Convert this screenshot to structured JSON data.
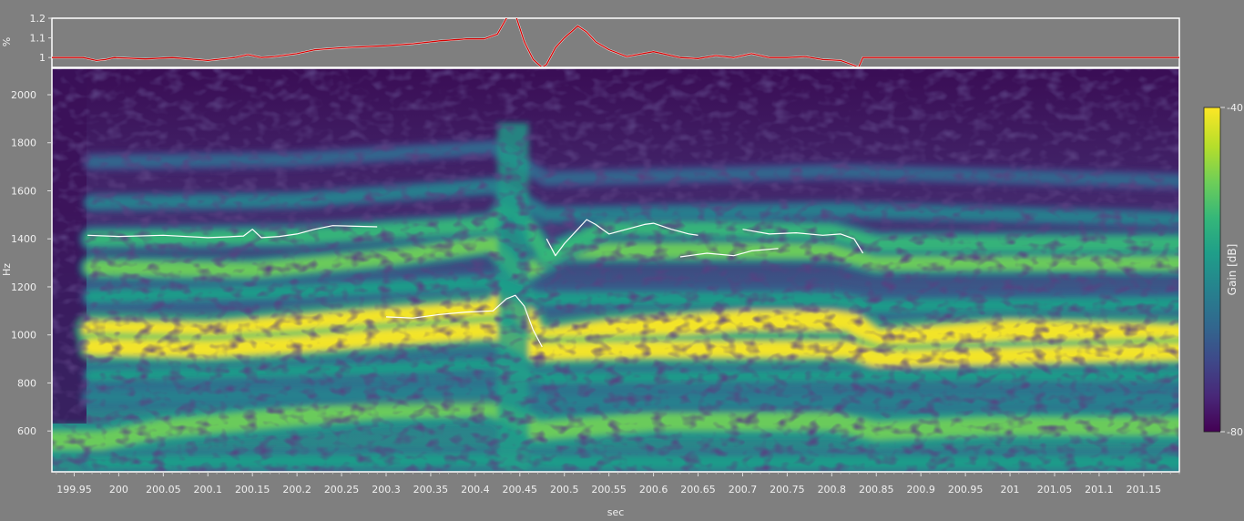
{
  "chart_data": [
    {
      "id": "ratio-panel",
      "type": "line",
      "ylabel": "%",
      "yticks": [
        "1",
        "1.1",
        "1.2"
      ],
      "ylim": [
        0.95,
        1.2
      ],
      "xlim": [
        199.925,
        201.19
      ],
      "colors": {
        "line": "#d40000",
        "line2": "#ffffff",
        "frame": "#ffffff"
      },
      "series": [
        {
          "x": [
            199.925,
            199.96,
            199.975,
            199.985,
            199.995,
            200.03,
            200.06,
            200.1,
            200.13,
            200.145,
            200.16,
            200.175,
            200.2,
            200.22,
            200.25,
            200.3,
            200.33,
            200.36,
            200.39,
            200.41,
            200.425,
            200.44,
            200.445,
            200.455,
            200.465,
            200.475,
            200.48,
            200.49,
            200.5,
            200.515,
            200.525,
            200.535,
            200.55,
            200.57,
            200.6,
            200.63,
            200.65,
            200.67,
            200.69,
            200.71,
            200.73,
            200.75,
            200.77,
            200.79,
            200.81,
            200.825,
            200.83,
            200.835,
            200.87,
            201.0,
            201.19
          ],
          "y": [
            1.0,
            1.0,
            0.985,
            0.99,
            1.0,
            0.993,
            1.0,
            0.985,
            1.0,
            1.015,
            1.0,
            1.005,
            1.02,
            1.04,
            1.05,
            1.06,
            1.07,
            1.085,
            1.095,
            1.095,
            1.12,
            1.24,
            1.22,
            1.08,
            0.99,
            0.95,
            0.965,
            1.05,
            1.1,
            1.16,
            1.13,
            1.08,
            1.04,
            1.005,
            1.03,
            1.0,
            0.995,
            1.01,
            1.0,
            1.02,
            1.0,
            1.0,
            1.005,
            0.99,
            0.985,
            0.96,
            0.95,
            1.0,
            1.0,
            1.0,
            1.0
          ]
        }
      ]
    },
    {
      "id": "spectrogram",
      "type": "heatmap",
      "xlabel": "sec",
      "ylabel": "Hz",
      "xlim": [
        199.925,
        201.19
      ],
      "ylim": [
        430,
        2110
      ],
      "xticks": [
        "199.95",
        "200",
        "200.05",
        "200.1",
        "200.15",
        "200.2",
        "200.25",
        "200.3",
        "200.35",
        "200.4",
        "200.45",
        "200.5",
        "200.55",
        "200.6",
        "200.65",
        "200.7",
        "200.75",
        "200.8",
        "200.85",
        "200.9",
        "200.95",
        "201",
        "201.05",
        "201.1",
        "201.15"
      ],
      "yticks": [
        "600",
        "800",
        "1000",
        "1200",
        "1400",
        "1600",
        "1800",
        "2000"
      ],
      "colorbar": {
        "label": "Gain [dB]",
        "min": -80,
        "max": -40,
        "max_label": "-40",
        "min_label": "-80"
      },
      "colormap": [
        "#440154",
        "#482878",
        "#3e4989",
        "#31688e",
        "#26828e",
        "#1f9e89",
        "#35b779",
        "#6ece58",
        "#b5de2b",
        "#fde725"
      ],
      "grid": false,
      "bands": [
        {
          "name": "",
          "level": 1.0,
          "width": 22,
          "points": [
            [
              199.97,
              1020
            ],
            [
              200.1,
              1010
            ],
            [
              200.2,
              1040
            ],
            [
              200.3,
              1070
            ],
            [
              200.42,
              1100
            ],
            [
              200.44,
              1180
            ],
            [
              200.47,
              980
            ],
            [
              200.55,
              1020
            ],
            [
              200.7,
              1060
            ],
            [
              200.82,
              1060
            ],
            [
              200.85,
              980
            ],
            [
              201.0,
              1020
            ],
            [
              201.19,
              1000
            ]
          ]
        },
        {
          "name": "",
          "level": 0.95,
          "width": 18,
          "points": [
            [
              199.97,
              950
            ],
            [
              200.1,
              940
            ],
            [
              200.2,
              960
            ],
            [
              200.3,
              990
            ],
            [
              200.42,
              1020
            ],
            [
              200.47,
              930
            ],
            [
              200.6,
              940
            ],
            [
              200.82,
              940
            ],
            [
              200.85,
              900
            ],
            [
              201.19,
              930
            ]
          ]
        },
        {
          "name": "",
          "level": 0.75,
          "width": 16,
          "points": [
            [
              199.97,
              1280
            ],
            [
              200.15,
              1270
            ],
            [
              200.3,
              1320
            ],
            [
              200.42,
              1380
            ],
            [
              200.45,
              1250
            ],
            [
              200.5,
              1350
            ],
            [
              200.8,
              1350
            ],
            [
              200.85,
              1300
            ],
            [
              201.19,
              1300
            ]
          ]
        },
        {
          "name": "",
          "level": 0.7,
          "width": 16,
          "points": [
            [
              199.97,
              1400
            ],
            [
              200.2,
              1410
            ],
            [
              200.42,
              1460
            ],
            [
              200.44,
              1550
            ],
            [
              200.48,
              1330
            ],
            [
              200.55,
              1450
            ],
            [
              200.8,
              1430
            ],
            [
              200.85,
              1380
            ],
            [
              201.19,
              1380
            ]
          ]
        },
        {
          "name": "",
          "level": 0.8,
          "width": 20,
          "points": [
            [
              199.925,
              560
            ],
            [
              199.98,
              560
            ],
            [
              200.05,
              610
            ],
            [
              200.2,
              660
            ],
            [
              200.3,
              690
            ],
            [
              200.42,
              700
            ],
            [
              200.47,
              600
            ],
            [
              200.6,
              640
            ],
            [
              200.8,
              640
            ],
            [
              200.85,
              600
            ],
            [
              200.97,
              620
            ],
            [
              201.19,
              620
            ]
          ]
        },
        {
          "name": "",
          "level": 0.55,
          "width": 14,
          "points": [
            [
              199.97,
              1160
            ],
            [
              200.2,
              1180
            ],
            [
              200.42,
              1220
            ],
            [
              200.47,
              1150
            ],
            [
              200.8,
              1150
            ],
            [
              200.85,
              1120
            ],
            [
              201.19,
              1130
            ]
          ]
        },
        {
          "name": "",
          "level": 0.5,
          "width": 12,
          "points": [
            [
              199.97,
              830
            ],
            [
              200.3,
              860
            ],
            [
              200.42,
              880
            ],
            [
              200.47,
              820
            ],
            [
              200.8,
              830
            ],
            [
              201.19,
              830
            ]
          ]
        },
        {
          "name": "",
          "level": 0.45,
          "width": 12,
          "points": [
            [
              199.97,
              1550
            ],
            [
              200.2,
              1560
            ],
            [
              200.42,
              1620
            ],
            [
              200.48,
              1500
            ],
            [
              200.8,
              1520
            ],
            [
              201.19,
              1480
            ]
          ]
        },
        {
          "name": "",
          "level": 0.35,
          "width": 12,
          "points": [
            [
              199.97,
              1720
            ],
            [
              200.2,
              1730
            ],
            [
              200.42,
              1780
            ],
            [
              200.48,
              1650
            ],
            [
              200.8,
              1680
            ],
            [
              201.19,
              1640
            ]
          ]
        },
        {
          "name": "",
          "level": 0.55,
          "width": 14,
          "points": [
            [
              199.97,
              470
            ],
            [
              200.42,
              480
            ],
            [
              200.5,
              470
            ],
            [
              201.19,
              470
            ]
          ]
        },
        {
          "name": "",
          "level": 0.45,
          "width": 14,
          "points": [
            [
              199.97,
              740
            ],
            [
              200.42,
              760
            ],
            [
              200.5,
              720
            ],
            [
              201.19,
              730
            ]
          ]
        }
      ],
      "tracks": [
        {
          "x": [
            199.965,
            200.0,
            200.05,
            200.1,
            200.12,
            200.14,
            200.15,
            200.16,
            200.18,
            200.2,
            200.22,
            200.24,
            200.29
          ],
          "y": [
            1415,
            1410,
            1415,
            1405,
            1408,
            1412,
            1440,
            1405,
            1410,
            1420,
            1440,
            1455,
            1450
          ]
        },
        {
          "x": [
            200.3,
            200.33,
            200.36,
            200.39,
            200.42,
            200.435,
            200.445,
            200.455,
            200.465,
            200.475
          ],
          "y": [
            1075,
            1070,
            1085,
            1095,
            1100,
            1150,
            1165,
            1120,
            1020,
            950
          ]
        },
        {
          "x": [
            200.48,
            200.49,
            200.5,
            200.515,
            200.525,
            200.535,
            200.55,
            200.57,
            200.59,
            200.6,
            200.62,
            200.64,
            200.65
          ],
          "y": [
            1400,
            1330,
            1380,
            1440,
            1480,
            1460,
            1420,
            1440,
            1460,
            1465,
            1440,
            1420,
            1415
          ]
        },
        {
          "x": [
            200.63,
            200.66,
            200.69,
            200.71,
            200.74
          ],
          "y": [
            1325,
            1340,
            1330,
            1350,
            1360
          ]
        },
        {
          "x": [
            200.7,
            200.73,
            200.76,
            200.79,
            200.81,
            200.825,
            200.835
          ],
          "y": [
            1440,
            1420,
            1425,
            1415,
            1420,
            1400,
            1340
          ]
        }
      ]
    }
  ]
}
